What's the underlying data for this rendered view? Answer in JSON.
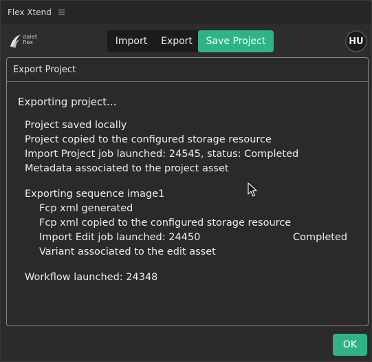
{
  "app": {
    "title": "Flex Xtend",
    "menu_icon": "hamburger-icon"
  },
  "toolbar": {
    "logo_line1": "dalet",
    "logo_line2": "flex",
    "tabs": [
      {
        "label": "Import",
        "active": false
      },
      {
        "label": "Export",
        "active": false
      },
      {
        "label": "Save Project",
        "active": true
      }
    ],
    "avatar_initials": "HU",
    "accent_color": "#2fb386"
  },
  "dialog": {
    "title": "Export Project",
    "heading": "Exporting project...",
    "lines": [
      "Project saved locally",
      "Project copied to the configured storage resource",
      "Import Project job launched: 24545, status: Completed",
      "Metadata associated to the project asset",
      "Exporting sequence image1",
      "Fcp xml generated",
      "Fcp xml copied to the configured storage resource",
      "Import Edit job launched: 24450",
      "Variant associated to the edit asset",
      "Workflow launched: 24348"
    ],
    "edit_job_status": "Completed",
    "ok_label": "OK"
  }
}
